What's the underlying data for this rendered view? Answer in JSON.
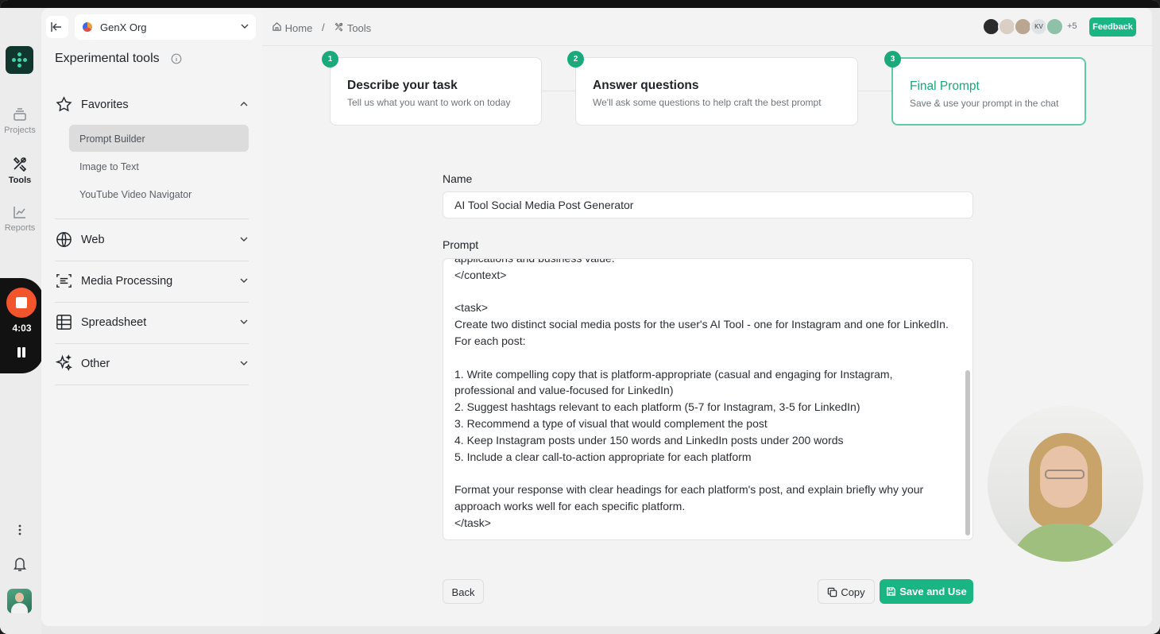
{
  "rail": {
    "items": [
      {
        "label": "Projects",
        "icon": "stack-icon"
      },
      {
        "label": "Tools",
        "icon": "tools-icon",
        "active": true
      },
      {
        "label": "Reports",
        "icon": "chart-line-icon"
      }
    ],
    "recorder_time": "4:03"
  },
  "sidebar": {
    "org_name": "GenX Org",
    "title": "Experimental tools",
    "favorites": {
      "label": "Favorites",
      "items": [
        "Prompt Builder",
        "Image to Text",
        "YouTube Video Navigator"
      ]
    },
    "groups": [
      {
        "label": "Web",
        "icon": "globe-icon"
      },
      {
        "label": "Media Processing",
        "icon": "scan-text-icon"
      },
      {
        "label": "Spreadsheet",
        "icon": "table-icon"
      },
      {
        "label": "Other",
        "icon": "sparkles-icon"
      }
    ]
  },
  "topbar": {
    "breadcrumb": {
      "home": "Home",
      "separator": "/",
      "current": "Tools"
    },
    "avatar_initials": "KV",
    "more_count": "+5",
    "feedback_label": "Feedback"
  },
  "steps": [
    {
      "number": "1",
      "title": "Describe your task",
      "subtitle": "Tell us what you want to work on today"
    },
    {
      "number": "2",
      "title": "Answer questions",
      "subtitle": "We'll ask some questions to help craft the best prompt"
    },
    {
      "number": "3",
      "title": "Final Prompt",
      "subtitle": "Save & use your prompt in the chat"
    }
  ],
  "form": {
    "name_label": "Name",
    "name_value": "AI Tool Social Media Post Generator",
    "prompt_label": "Prompt",
    "prompt_value": "applications and business value.\n</context>\n\n<task>\nCreate two distinct social media posts for the user's AI Tool - one for Instagram and one for LinkedIn. For each post:\n\n1. Write compelling copy that is platform-appropriate (casual and engaging for Instagram, professional and value-focused for LinkedIn)\n2. Suggest hashtags relevant to each platform (5-7 for Instagram, 3-5 for LinkedIn)\n3. Recommend a type of visual that would complement the post\n4. Keep Instagram posts under 150 words and LinkedIn posts under 200 words\n5. Include a clear call-to-action appropriate for each platform\n\nFormat your response with clear headings for each platform's post, and explain briefly why your approach works well for each specific platform.\n</task>"
  },
  "actions": {
    "back_label": "Back",
    "copy_label": "Copy",
    "save_label": "Save and Use"
  },
  "colors": {
    "accent": "#19b582",
    "logo_bg": "#11362e",
    "recorder": "#f2552c"
  }
}
